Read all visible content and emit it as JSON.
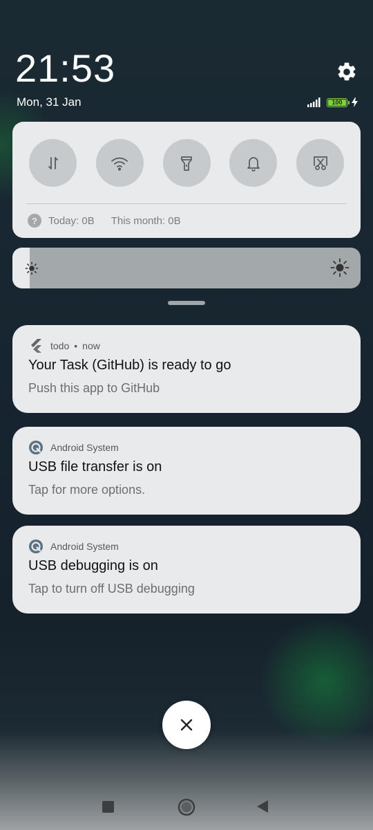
{
  "header": {
    "time": "21:53",
    "date": "Mon, 31 Jan",
    "battery_level": "100",
    "battery_color": "#7fd13b",
    "icons": [
      "settings-gear-icon",
      "signal-bars-icon",
      "battery-icon",
      "charging-bolt-icon"
    ]
  },
  "quick_settings": {
    "tiles": [
      {
        "name": "mobile-data",
        "icon": "data-arrows-icon"
      },
      {
        "name": "wifi",
        "icon": "wifi-icon"
      },
      {
        "name": "flashlight",
        "icon": "flashlight-icon"
      },
      {
        "name": "sound",
        "icon": "bell-icon"
      },
      {
        "name": "screenshot",
        "icon": "scissors-icon"
      }
    ],
    "data_today": "Today: 0B",
    "data_month": "This month: 0B",
    "help_glyph": "?"
  },
  "brightness": {
    "level_percent": 5,
    "icons": [
      "brightness-low-icon",
      "brightness-high-icon"
    ]
  },
  "notifications": [
    {
      "app": "todo",
      "time": "now",
      "title": "Your Task (GitHub) is ready to go",
      "body": "Push this app to GitHub",
      "icon": "flutter-icon"
    },
    {
      "app": "Android System",
      "title": "USB file transfer is on",
      "body": "Tap for more options.",
      "icon": "android-system-icon"
    },
    {
      "app": "Android System",
      "title": "USB debugging is on",
      "body": "Tap to turn off USB debugging",
      "icon": "android-system-icon"
    }
  ],
  "dismiss": {
    "icon": "close-icon",
    "glyph": "×"
  },
  "navbar": {
    "icons": [
      "recents-icon",
      "home-icon",
      "back-icon"
    ]
  }
}
